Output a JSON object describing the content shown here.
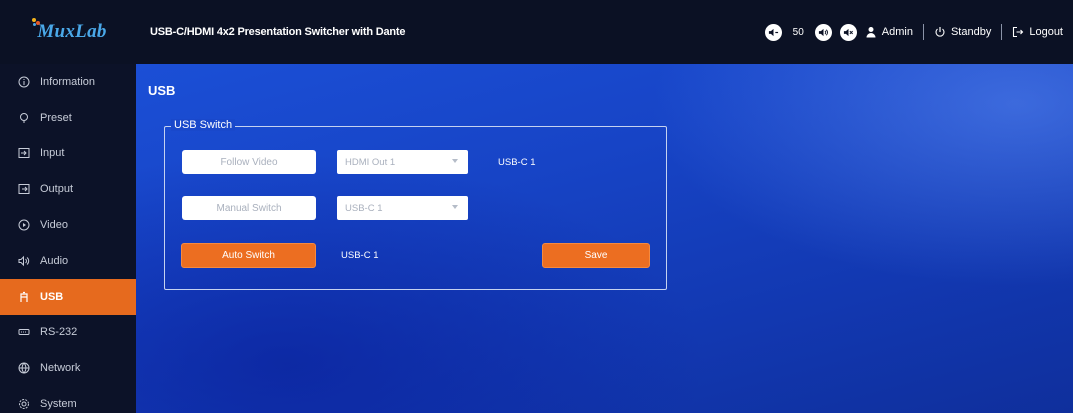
{
  "header": {
    "logo_text": "MuxLab",
    "device_title": "USB-C/HDMI 4x2 Presentation Switcher with Dante",
    "volume_value": "50",
    "user_label": "Admin",
    "standby_label": "Standby",
    "logout_label": "Logout",
    "icons": [
      "volume-down-icon",
      "volume-up-icon",
      "mute-icon",
      "user-icon",
      "power-icon",
      "logout-icon"
    ]
  },
  "sidebar": {
    "items": [
      {
        "label": "Information",
        "icon": "info-icon"
      },
      {
        "label": "Preset",
        "icon": "preset-icon"
      },
      {
        "label": "Input",
        "icon": "input-icon"
      },
      {
        "label": "Output",
        "icon": "output-icon"
      },
      {
        "label": "Video",
        "icon": "video-icon"
      },
      {
        "label": "Audio",
        "icon": "audio-icon"
      },
      {
        "label": "USB",
        "icon": "usb-icon",
        "active": true
      },
      {
        "label": "RS-232",
        "icon": "rs232-icon"
      },
      {
        "label": "Network",
        "icon": "network-icon"
      },
      {
        "label": "System",
        "icon": "system-icon"
      }
    ]
  },
  "main": {
    "title": "USB",
    "group_label": "USB Switch",
    "follow_video_label": "Follow Video",
    "follow_video_select": "HDMI Out 1",
    "follow_video_status": "USB-C 1",
    "manual_switch_label": "Manual Switch",
    "manual_switch_select": "USB-C 1",
    "auto_switch_label": "Auto Switch",
    "auto_switch_status": "USB-C 1",
    "save_label": "Save"
  },
  "colors": {
    "accent": "#e66a1e",
    "sidebar_bg": "#0c1228",
    "main_bg": "#1744c6",
    "logo": "#4aa8e8"
  }
}
